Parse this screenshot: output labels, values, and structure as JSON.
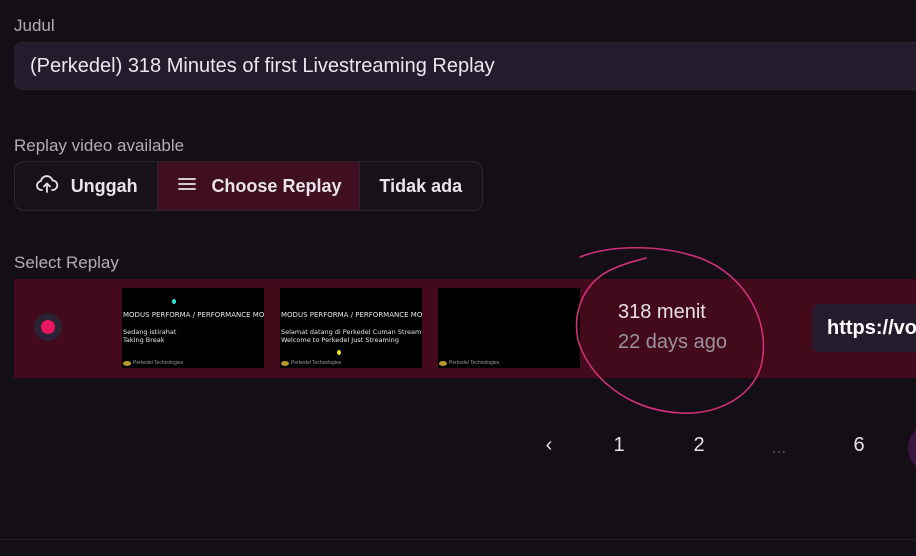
{
  "title_field": {
    "label": "Judul",
    "value": "(Perkedel) 318 Minutes of first Livestreaming Replay"
  },
  "replay_source": {
    "label": "Replay video available",
    "options": [
      {
        "label": "Unggah",
        "icon": "upload-cloud-icon",
        "selected": false
      },
      {
        "label": "Choose Replay",
        "icon": "menu-lines-icon",
        "selected": true
      },
      {
        "label": "Tidak ada",
        "selected": false
      }
    ]
  },
  "select_replay": {
    "label": "Select Replay",
    "item": {
      "selected": true,
      "thumbnails": [
        {
          "heading": "MODUS PERFORMA / PERFORMANCE MODE",
          "lines": [
            "Sedang istirahat",
            "Taking Break"
          ],
          "watermark": "Perkedel Technologies"
        },
        {
          "heading": "MODUS PERFORMA / PERFORMANCE MODE",
          "lines": [
            "Selamat datang di Perkedel Cuman Streaming",
            "Welcome to Perkedel Just Streaming"
          ],
          "watermark": "Perkedel Technologies"
        },
        {
          "heading": "",
          "lines": [],
          "watermark": "Perkedel Technologies"
        }
      ],
      "duration": "318 menit",
      "age": "22 days ago",
      "url": "https://vo"
    }
  },
  "pagination": {
    "prev": "‹",
    "pages": [
      "1",
      "2",
      "...",
      "6"
    ]
  },
  "colors": {
    "background": "#140f17",
    "selected_row": "#420a1b",
    "accent": "#e8175f",
    "annotation": "#d2307a"
  }
}
